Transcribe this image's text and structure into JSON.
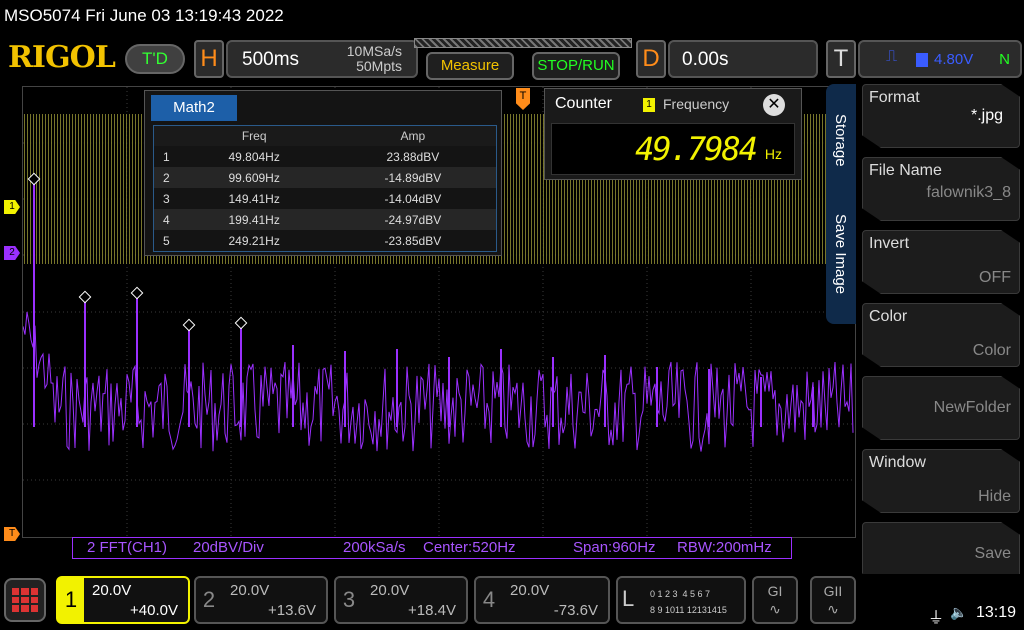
{
  "title": "MSO5074  Fri June 03 13:19:43 2022",
  "logo": "RIGOL",
  "td_label": "T'D",
  "horizontal": {
    "letter": "H",
    "timebase": "500ms",
    "sample_rate": "10MSa/s",
    "memory_depth": "50Mpts"
  },
  "buttons": {
    "measure": "Measure",
    "stop_run": "STOP/RUN"
  },
  "delay": {
    "letter": "D",
    "value": "0.00s"
  },
  "trigger": {
    "letter": "T",
    "edge": "⎍",
    "source": "1",
    "level": "4.80V",
    "mode": "N"
  },
  "markers": {
    "ch1": "1",
    "ch2": "2",
    "trig": "T",
    "tpos": "T"
  },
  "math_window": {
    "tab": "Math2",
    "headers": [
      "",
      "Freq",
      "Amp"
    ],
    "rows": [
      {
        "n": "1",
        "freq": "49.804Hz",
        "amp": "23.88dBV"
      },
      {
        "n": "2",
        "freq": "99.609Hz",
        "amp": "-14.89dBV"
      },
      {
        "n": "3",
        "freq": "149.41Hz",
        "amp": "-14.04dBV"
      },
      {
        "n": "4",
        "freq": "199.41Hz",
        "amp": "-24.97dBV"
      },
      {
        "n": "5",
        "freq": "249.21Hz",
        "amp": "-23.85dBV"
      }
    ]
  },
  "counter": {
    "title": "Counter",
    "source": "1",
    "type": "Frequency",
    "value": "49.7984",
    "unit": "Hz",
    "close": "✕"
  },
  "fft_info": {
    "name": "2  FFT(CH1)",
    "scale": "20dBV/Div",
    "rate": "200kSa/s",
    "center": "Center:520Hz",
    "span": "Span:960Hz",
    "rbw": "RBW:200mHz"
  },
  "menu": {
    "tabs": [
      "Storage",
      "Save Image"
    ],
    "items": [
      {
        "label": "Format",
        "value": "*.jpg"
      },
      {
        "label": "File Name",
        "value": "falownik3_8"
      },
      {
        "label": "Invert",
        "value": "OFF"
      },
      {
        "label": "Color",
        "value": "Color"
      },
      {
        "label": "",
        "value": "NewFolder"
      },
      {
        "label": "Window",
        "value": "Hide"
      },
      {
        "label": "",
        "value": "Save"
      }
    ]
  },
  "channels": [
    {
      "num": "1",
      "scale": "20.0V",
      "offset": "+40.0V"
    },
    {
      "num": "2",
      "scale": "20.0V",
      "offset": "+13.6V"
    },
    {
      "num": "3",
      "scale": "20.0V",
      "offset": "+18.4V"
    },
    {
      "num": "4",
      "scale": "20.0V",
      "offset": "-73.6V"
    }
  ],
  "logic": {
    "letter": "L",
    "row1": "0 1 2 3  4 5 6 7",
    "row2": "8 9 1011 12131415"
  },
  "gen": {
    "g1": "GI",
    "g2": "GII"
  },
  "status": {
    "usb": "⏚",
    "sound": "🔈",
    "time": "13:19"
  },
  "colors": {
    "ch1": "#f2f200",
    "ch2_fft": "#9b30ff",
    "trigger": "#ff8c1a",
    "accent": "#1d5fa8"
  }
}
